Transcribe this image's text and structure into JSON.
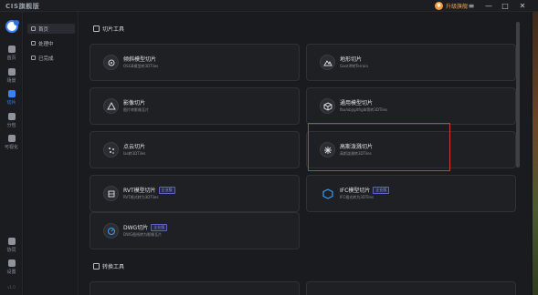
{
  "app": {
    "logo": "CIS旗舰版",
    "upgrade_label": "升级旗舰",
    "upgrade_coin": "¥"
  },
  "window_controls": {
    "menu": "≡",
    "minimize": "—",
    "maximize": "□",
    "close": "✕"
  },
  "rail": {
    "items": [
      {
        "label": "首页"
      },
      {
        "label": "场景"
      },
      {
        "label": "切片"
      },
      {
        "label": "分包"
      },
      {
        "label": "可视化"
      }
    ],
    "bottom": [
      {
        "label": "协同"
      },
      {
        "label": "设置"
      }
    ],
    "version": "v1.0"
  },
  "menu": {
    "items": [
      {
        "label": "首页",
        "active": true
      },
      {
        "label": "处理中",
        "active": false
      },
      {
        "label": "已完成",
        "active": false
      }
    ]
  },
  "sections": {
    "slice_tools": "切片工具",
    "convert_tools": "转换工具"
  },
  "cards": [
    {
      "title": "倾斜模型切片",
      "subtitle": "OSGB模型转3DTiles",
      "icon": "tilt-model-icon",
      "tag": ""
    },
    {
      "title": "地形切片",
      "subtitle": "Geotiff转Terrain",
      "icon": "terrain-icon",
      "tag": ""
    },
    {
      "title": "影像切片",
      "subtitle": "图片转影像瓦片",
      "icon": "imagery-icon",
      "tag": ""
    },
    {
      "title": "通用模型切片",
      "subtitle": "fbx/obj/gltf/glb等转3DTiles",
      "icon": "generic-model-icon",
      "tag": ""
    },
    {
      "title": "点云切片",
      "subtitle": "las转3DTiles",
      "icon": "point-cloud-icon",
      "tag": ""
    },
    {
      "title": "高斯泼溅切片",
      "subtitle": "高斯泼溅转3DTiles",
      "icon": "gaussian-splat-icon",
      "tag": ""
    },
    {
      "title": "RVT模型切片",
      "subtitle": "RVT格式转为3DTiles",
      "icon": "rvt-icon",
      "tag": "企业版"
    },
    {
      "title": "IFC模型切片",
      "subtitle": "IFC格式转为3DTiles",
      "icon": "ifc-icon",
      "tag": "企业版"
    },
    {
      "title": "DWG切片",
      "subtitle": "DWG图纸转为影像瓦片",
      "icon": "dwg-icon",
      "tag": "企业版"
    }
  ],
  "colors": {
    "accent": "#3b82f6",
    "highlight": "#d9362e",
    "upgrade": "#f29a3d"
  }
}
